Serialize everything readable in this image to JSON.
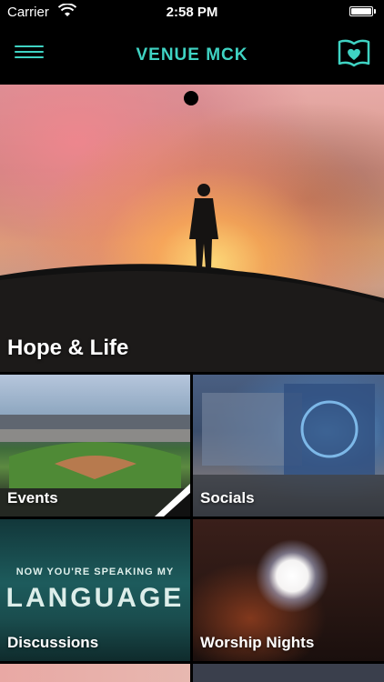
{
  "status_bar": {
    "carrier": "Carrier",
    "time": "2:58 PM",
    "icons": [
      "wifi-icon",
      "battery-icon"
    ]
  },
  "nav": {
    "title": "VENUE MCK",
    "menu_icon": "hamburger-menu-icon",
    "bible_icon": "bible-heart-icon",
    "accent_color": "#3fd3c3"
  },
  "tiles": {
    "hero": {
      "label": "Hope & Life"
    },
    "events": {
      "label": "Events"
    },
    "socials": {
      "label": "Socials"
    },
    "discussions": {
      "label": "Discussions",
      "art_line1": "NOW YOU'RE SPEAKING MY",
      "art_line2": "LANGUAGE"
    },
    "worship": {
      "label": "Worship Nights"
    }
  }
}
